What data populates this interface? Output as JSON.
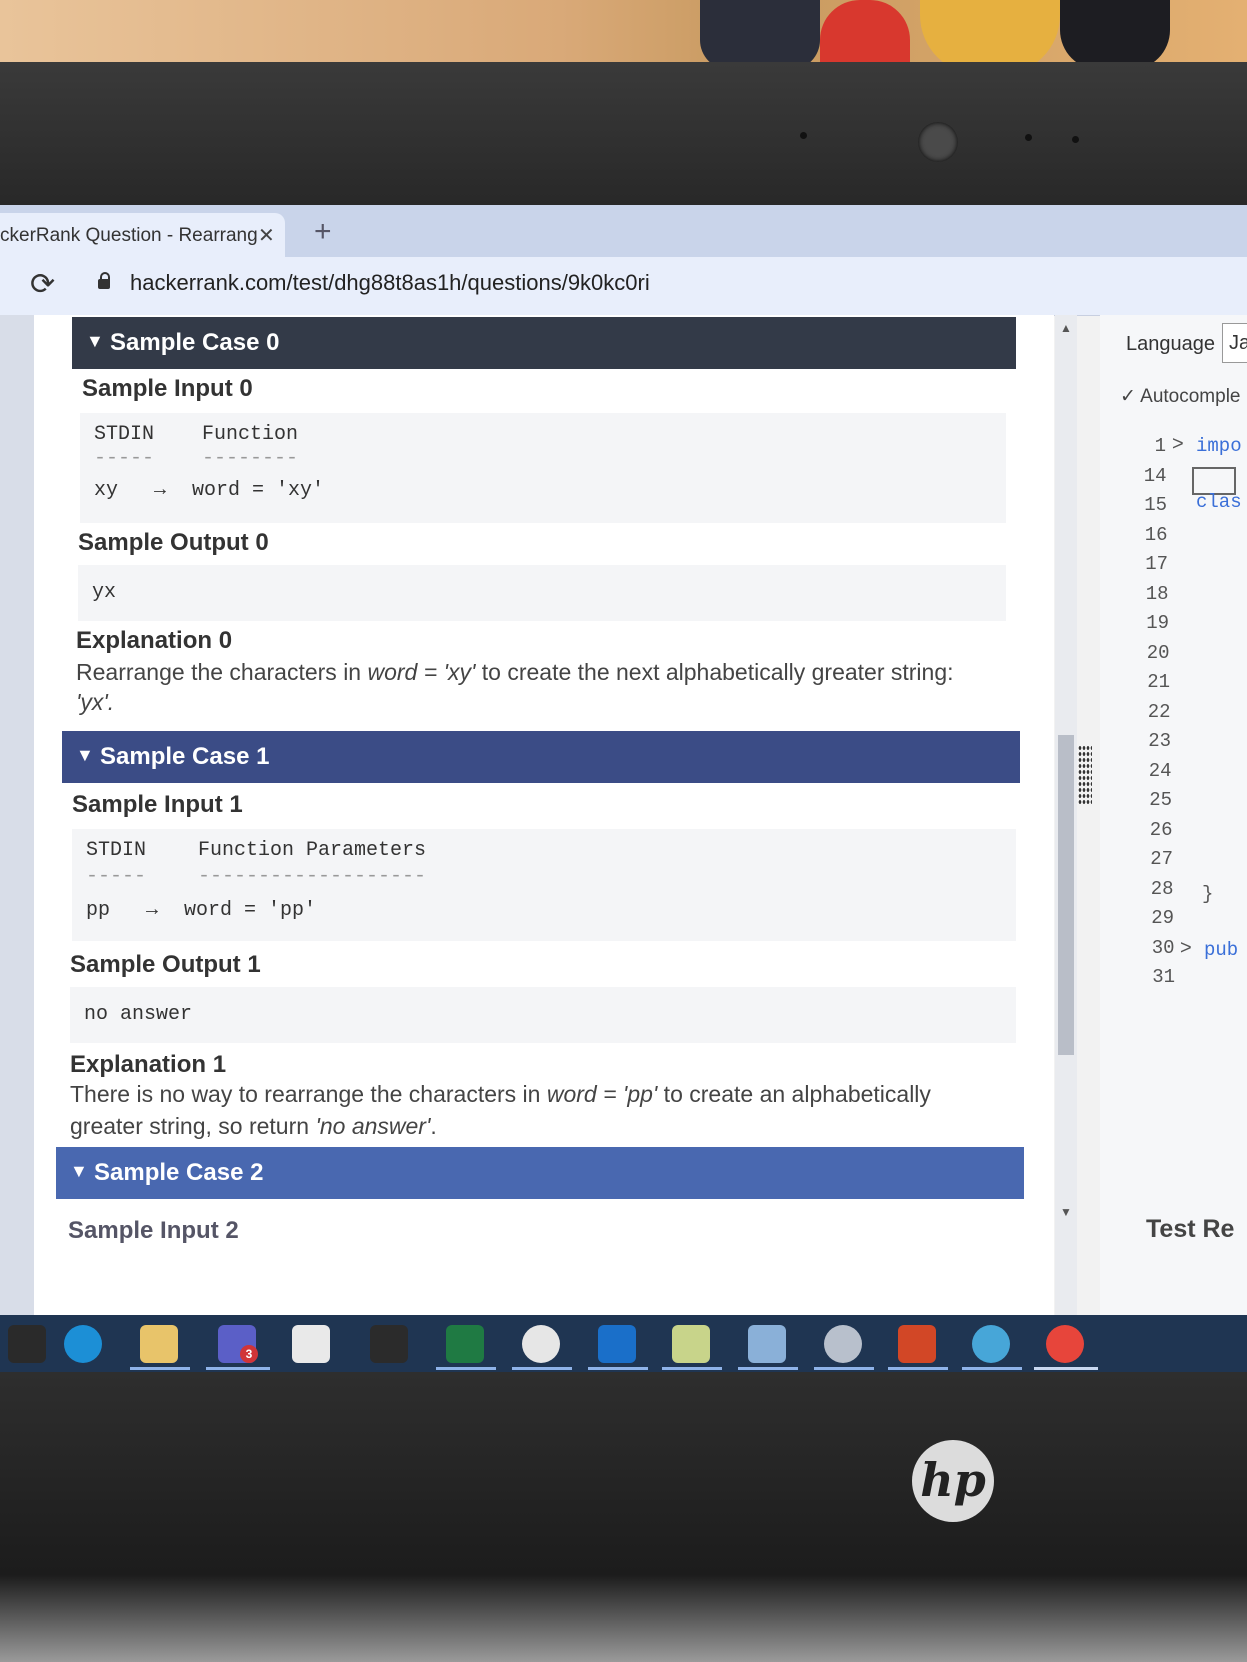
{
  "browser": {
    "tab_title": "ckerRank Question - Rearrang",
    "tab_close": "✕",
    "new_tab": "+",
    "reload": "⟳",
    "url": "hackerrank.com/test/dhg88t8as1h/questions/9k0kc0ri"
  },
  "cases": {
    "case0": {
      "title": "Sample Case 0",
      "input_label": "Sample Input 0",
      "stdin_header": "STDIN",
      "function_header": "Function",
      "stdin_rule": "-----",
      "function_rule": "--------",
      "input_value": "xy",
      "arrow": "→",
      "assignment": "word = 'xy'",
      "output_label": "Sample Output 0",
      "output_value": "yx",
      "explanation_label": "Explanation 0",
      "explanation_line1_a": "Rearrange the characters in ",
      "explanation_line1_b": "word = 'xy'",
      "explanation_line1_c": " to create the next alphabetically greater string:",
      "explanation_line2": "'yx'."
    },
    "case1": {
      "title": "Sample Case 1",
      "input_label": "Sample Input 1",
      "stdin_header": "STDIN",
      "function_header": "Function Parameters",
      "stdin_rule": "-----",
      "function_rule": "-------------------",
      "input_value": "pp",
      "arrow": "→",
      "assignment": "word = 'pp'",
      "output_label": "Sample Output 1",
      "output_value": "no answer",
      "explanation_label": "Explanation 1",
      "explanation_line1_a": "There is no way to rearrange the characters in ",
      "explanation_line1_b": "word = 'pp'",
      "explanation_line1_c": " to create an alphabetically",
      "explanation_line2_a": "greater string, so return ",
      "explanation_line2_b": "'no answer'",
      "explanation_line2_c": "."
    },
    "case2": {
      "title": "Sample Case 2",
      "input_label": "Sample Input 2"
    },
    "arrow_icon": "▼"
  },
  "editor": {
    "language_label": "Language",
    "language_value": "Ja",
    "autocomplete_label": "Autocomple",
    "line_numbers": [
      "1",
      "14",
      "15",
      "16",
      "17",
      "18",
      "19",
      "20",
      "21",
      "22",
      "23",
      "24",
      "25",
      "26",
      "27",
      "28",
      "29",
      "30",
      "31"
    ],
    "line1_code": "impo",
    "line15_code": "clas",
    "line29_code": "}",
    "line31_code": "pub",
    "fold_icon": ">",
    "test_results_label": "Test Re"
  },
  "taskbar": {
    "teams_badge": "3",
    "colors": {
      "edge": "#1c8fd6",
      "explorer": "#e8c46a",
      "teams": "#5b5fc7",
      "store": "#e9e9e9",
      "terminal": "#2b2b2b",
      "excel": "#1f7a43",
      "outlook": "#1a6fc9",
      "powerpoint": "#d24726",
      "chrome": "#e7453b"
    }
  }
}
